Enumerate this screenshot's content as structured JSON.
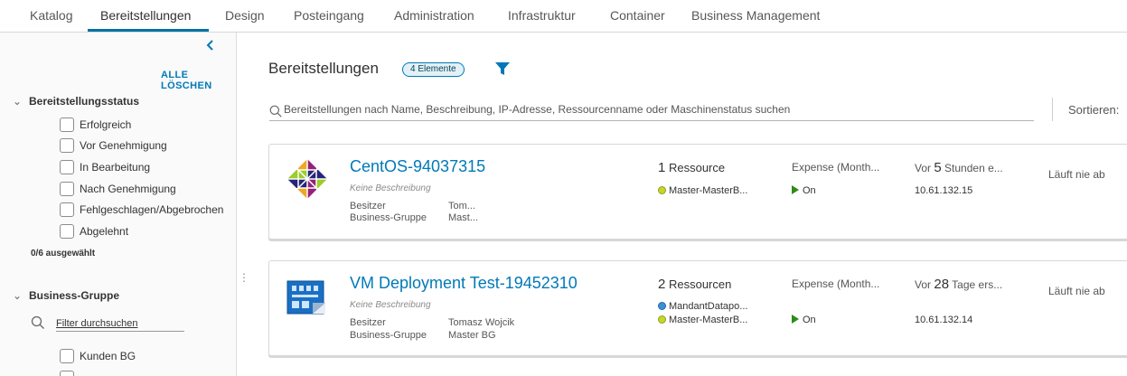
{
  "nav": {
    "tabs": [
      {
        "label": "Katalog"
      },
      {
        "label": "Bereitstellungen"
      },
      {
        "label": "Design"
      },
      {
        "label": "Posteingang"
      },
      {
        "label": "Administration"
      },
      {
        "label": "Infrastruktur"
      },
      {
        "label": "Container"
      },
      {
        "label": "Business Management"
      }
    ],
    "active_tab": "Bereitstellungen"
  },
  "sidebar": {
    "clear_all": "ALLE LÖSCHEN",
    "status_section": {
      "title": "Bereitstellungsstatus",
      "options": [
        {
          "label": "Erfolgreich",
          "checked": false
        },
        {
          "label": "Vor Genehmigung",
          "checked": false
        },
        {
          "label": "In Bearbeitung",
          "checked": false
        },
        {
          "label": "Nach Genehmigung",
          "checked": false
        },
        {
          "label": "Fehlgeschlagen/Abgebrochen",
          "checked": false
        },
        {
          "label": "Abgelehnt",
          "checked": false
        }
      ],
      "selected_count": "0/6 ausgewählt"
    },
    "group_section": {
      "title": "Business-Gruppe",
      "filter_placeholder": "Filter durchsuchen",
      "options": [
        {
          "label": "Kunden BG",
          "checked": false
        }
      ]
    }
  },
  "main": {
    "title": "Bereitstellungen",
    "count_badge": "4 Elemente",
    "search_placeholder": "Bereitstellungen nach Name, Beschreibung, IP-Adresse, Ressourcenname oder Maschinenstatus suchen",
    "sort_label": "Sortieren:",
    "deployments": [
      {
        "name": "CentOS-94037315",
        "description": "Keine Beschreibung",
        "owner_label": "Besitzer",
        "owner": "Tom...",
        "group_label": "Business-Gruppe",
        "group": "Mast...",
        "resource_count": "1",
        "resource_word": "Ressource",
        "resources": [
          "Master-MasterB..."
        ],
        "expense": "Expense (Month...",
        "power": "On",
        "created_prefix": "Vor",
        "created_num": "5",
        "created_suffix": "Stunden e...",
        "ip": "10.61.132.15",
        "lease": "Läuft nie ab",
        "logo": "centos-logo-icon"
      },
      {
        "name": "VM Deployment Test-19452310",
        "description": "Keine Beschreibung",
        "owner_label": "Besitzer",
        "owner": "Tomasz Wojcik",
        "group_label": "Business-Gruppe",
        "group": "Master BG",
        "resource_count": "2",
        "resource_word": "Ressourcen",
        "resources": [
          "MandantDatapo...",
          "Master-MasterB..."
        ],
        "expense": "Expense (Month...",
        "power": "On",
        "created_prefix": "Vor",
        "created_num": "28",
        "created_suffix": "Tage ers...",
        "ip": "10.61.132.14",
        "lease": "Läuft nie ab",
        "logo": "blueprint-logo-icon"
      }
    ]
  },
  "colors": {
    "accent": "#0079b8",
    "power_on": "#2e8b17"
  }
}
